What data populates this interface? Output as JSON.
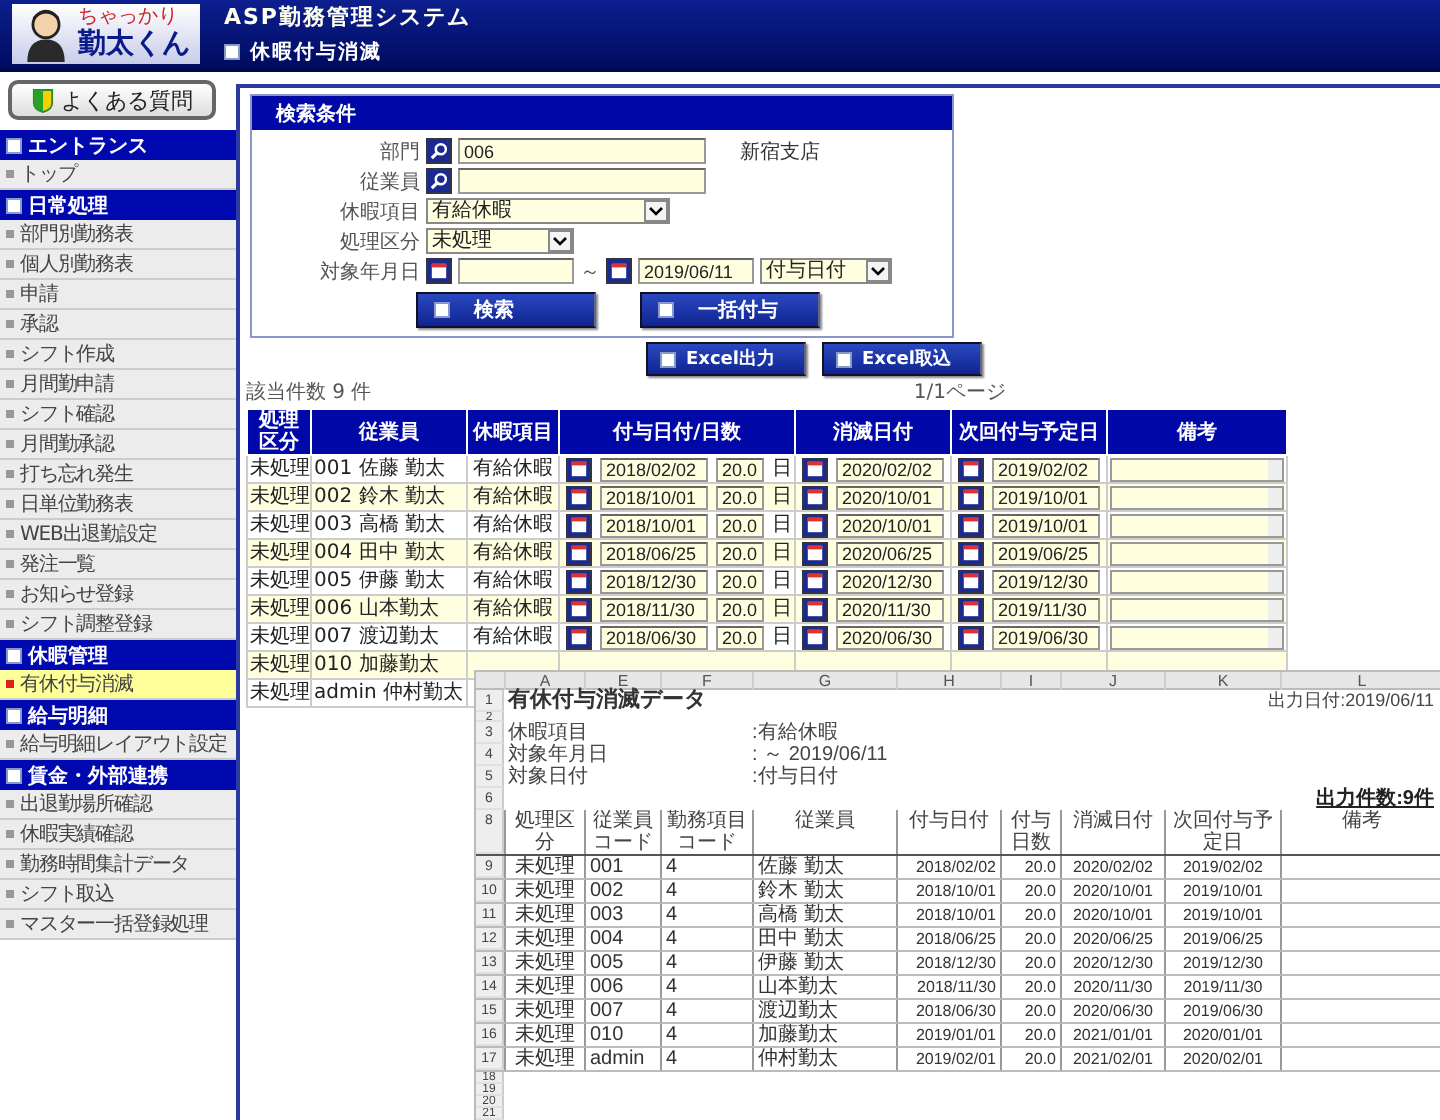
{
  "header": {
    "logo_small": "ちゃっかり",
    "logo": "勤太くん",
    "system": "ASP勤務管理システム",
    "page": "休暇付与消滅"
  },
  "sidebar": {
    "faq": "よくある質問",
    "sections": [
      {
        "title": "エントランス",
        "items": [
          {
            "label": "トップ",
            "selected": false
          }
        ]
      },
      {
        "title": "日常処理",
        "items": [
          {
            "label": "部門別勤務表",
            "selected": false
          },
          {
            "label": "個人別勤務表",
            "selected": false
          },
          {
            "label": "申請",
            "selected": false
          },
          {
            "label": "承認",
            "selected": false
          },
          {
            "label": "シフト作成",
            "selected": false
          },
          {
            "label": "月間勤申請",
            "selected": false
          },
          {
            "label": "シフト確認",
            "selected": false
          },
          {
            "label": "月間勤承認",
            "selected": false
          },
          {
            "label": "打ち忘れ発生",
            "selected": false
          },
          {
            "label": "日単位勤務表",
            "selected": false
          },
          {
            "label": "WEB出退勤設定",
            "selected": false
          },
          {
            "label": "発注一覧",
            "selected": false
          },
          {
            "label": "お知らせ登録",
            "selected": false
          },
          {
            "label": "シフト調整登録",
            "selected": false
          }
        ]
      },
      {
        "title": "休暇管理",
        "items": [
          {
            "label": "有休付与消滅",
            "selected": true
          }
        ]
      },
      {
        "title": "給与明細",
        "items": [
          {
            "label": "給与明細レイアウト設定",
            "selected": false
          }
        ]
      },
      {
        "title": "賃金・外部連携",
        "items": [
          {
            "label": "出退勤場所確認",
            "selected": false
          },
          {
            "label": "休暇実績確認",
            "selected": false
          },
          {
            "label": "勤務時間集計データ",
            "selected": false
          },
          {
            "label": "シフト取込",
            "selected": false
          },
          {
            "label": "マスター一括登録処理",
            "selected": false
          }
        ]
      }
    ]
  },
  "search": {
    "title": "検索条件",
    "fields": [
      {
        "kind": "lookup",
        "label": "部門",
        "value": "006",
        "note": "新宿支店"
      },
      {
        "kind": "lookup",
        "label": "従業員"
      },
      {
        "kind": "select",
        "label": "休暇項目",
        "value": "有給休暇"
      },
      {
        "kind": "select",
        "label": "処理区分",
        "value": "未処理"
      },
      {
        "kind": "daterange",
        "label": "対象年月日",
        "separator": "～",
        "to": "2019/06/11",
        "basis": "付与日付"
      }
    ],
    "buttons": [
      "検索",
      "一括付与"
    ]
  },
  "excel_buttons": [
    "Excel出力",
    "Excel取込"
  ],
  "result_count": "該当件数 9 件",
  "pager": "1/1ページ",
  "table": {
    "columns": [
      "処理区分",
      "従業員",
      "休暇項目",
      "付与日付/日数",
      "消滅日付",
      "次回付与予定日",
      "備考"
    ],
    "rows": [
      {
        "status": "未処理",
        "employee": "001 佐藤 勤太",
        "leave": "有給休暇",
        "grant_date": "2018/02/02",
        "days": "20.0",
        "unit": "日",
        "expire_date": "2020/02/02",
        "next_date": "2019/02/02"
      },
      {
        "status": "未処理",
        "employee": "002 鈴木 勤太",
        "leave": "有給休暇",
        "grant_date": "2018/10/01",
        "days": "20.0",
        "unit": "日",
        "expire_date": "2020/10/01",
        "next_date": "2019/10/01"
      },
      {
        "status": "未処理",
        "employee": "003 高橋 勤太",
        "leave": "有給休暇",
        "grant_date": "2018/10/01",
        "days": "20.0",
        "unit": "日",
        "expire_date": "2020/10/01",
        "next_date": "2019/10/01"
      },
      {
        "status": "未処理",
        "employee": "004 田中 勤太",
        "leave": "有給休暇",
        "grant_date": "2018/06/25",
        "days": "20.0",
        "unit": "日",
        "expire_date": "2020/06/25",
        "next_date": "2019/06/25"
      },
      {
        "status": "未処理",
        "employee": "005 伊藤 勤太",
        "leave": "有給休暇",
        "grant_date": "2018/12/30",
        "days": "20.0",
        "unit": "日",
        "expire_date": "2020/12/30",
        "next_date": "2019/12/30"
      },
      {
        "status": "未処理",
        "employee": "006 山本勤太",
        "leave": "有給休暇",
        "grant_date": "2018/11/30",
        "days": "20.0",
        "unit": "日",
        "expire_date": "2020/11/30",
        "next_date": "2019/11/30"
      },
      {
        "status": "未処理",
        "employee": "007 渡辺勤太",
        "leave": "有給休暇",
        "grant_date": "2018/06/30",
        "days": "20.0",
        "unit": "日",
        "expire_date": "2020/06/30",
        "next_date": "2019/06/30"
      },
      {
        "status": "未処理",
        "employee": "010 加藤勤太"
      },
      {
        "status": "未処理",
        "employee": "admin 仲村勤太"
      }
    ]
  },
  "spreadsheet": {
    "columns": [
      "A",
      "E",
      "F",
      "G",
      "H",
      "I",
      "J",
      "K",
      "L"
    ],
    "title": {
      "num": "1",
      "text": "有休付与消滅データ",
      "output_date": "出力日付:2019/06/11"
    },
    "blank_rows": [
      "2"
    ],
    "params": [
      {
        "num": "3",
        "label": "休暇項目",
        "value": ":有給休暇"
      },
      {
        "num": "4",
        "label": "対象年月日",
        "value": ": ～ 2019/06/11"
      },
      {
        "num": "5",
        "label": "対象日付",
        "value": ":付与日付"
      }
    ],
    "count": {
      "num": "6",
      "text": "出力件数:9件"
    },
    "header": {
      "num": "8",
      "cells": [
        "処理区分",
        "従業員コード",
        "勤務項目コード",
        "従業員",
        "付与日付",
        "付与日数",
        "消滅日付",
        "次回付与予定日",
        "備考"
      ]
    },
    "rows": [
      {
        "num": "9",
        "cells": [
          "未処理",
          "001",
          "4",
          "佐藤 勤太",
          "2018/02/02",
          "20.0",
          "2020/02/02",
          "2019/02/02"
        ]
      },
      {
        "num": "10",
        "cells": [
          "未処理",
          "002",
          "4",
          "鈴木 勤太",
          "2018/10/01",
          "20.0",
          "2020/10/01",
          "2019/10/01"
        ]
      },
      {
        "num": "11",
        "cells": [
          "未処理",
          "003",
          "4",
          "高橋 勤太",
          "2018/10/01",
          "20.0",
          "2020/10/01",
          "2019/10/01"
        ]
      },
      {
        "num": "12",
        "cells": [
          "未処理",
          "004",
          "4",
          "田中 勤太",
          "2018/06/25",
          "20.0",
          "2020/06/25",
          "2019/06/25"
        ]
      },
      {
        "num": "13",
        "cells": [
          "未処理",
          "005",
          "4",
          "伊藤 勤太",
          "2018/12/30",
          "20.0",
          "2020/12/30",
          "2019/12/30"
        ]
      },
      {
        "num": "14",
        "cells": [
          "未処理",
          "006",
          "4",
          "山本勤太",
          "2018/11/30",
          "20.0",
          "2020/11/30",
          "2019/11/30"
        ]
      },
      {
        "num": "15",
        "cells": [
          "未処理",
          "007",
          "4",
          "渡辺勤太",
          "2018/06/30",
          "20.0",
          "2020/06/30",
          "2019/06/30"
        ]
      },
      {
        "num": "16",
        "cells": [
          "未処理",
          "010",
          "4",
          "加藤勤太",
          "2019/01/01",
          "20.0",
          "2021/01/01",
          "2020/01/01"
        ]
      },
      {
        "num": "17",
        "cells": [
          "未処理",
          "admin",
          "4",
          "仲村勤太",
          "2019/02/01",
          "20.0",
          "2021/02/01",
          "2020/02/01"
        ]
      }
    ],
    "empty_rows": [
      "18",
      "19",
      "20",
      "21"
    ]
  }
}
